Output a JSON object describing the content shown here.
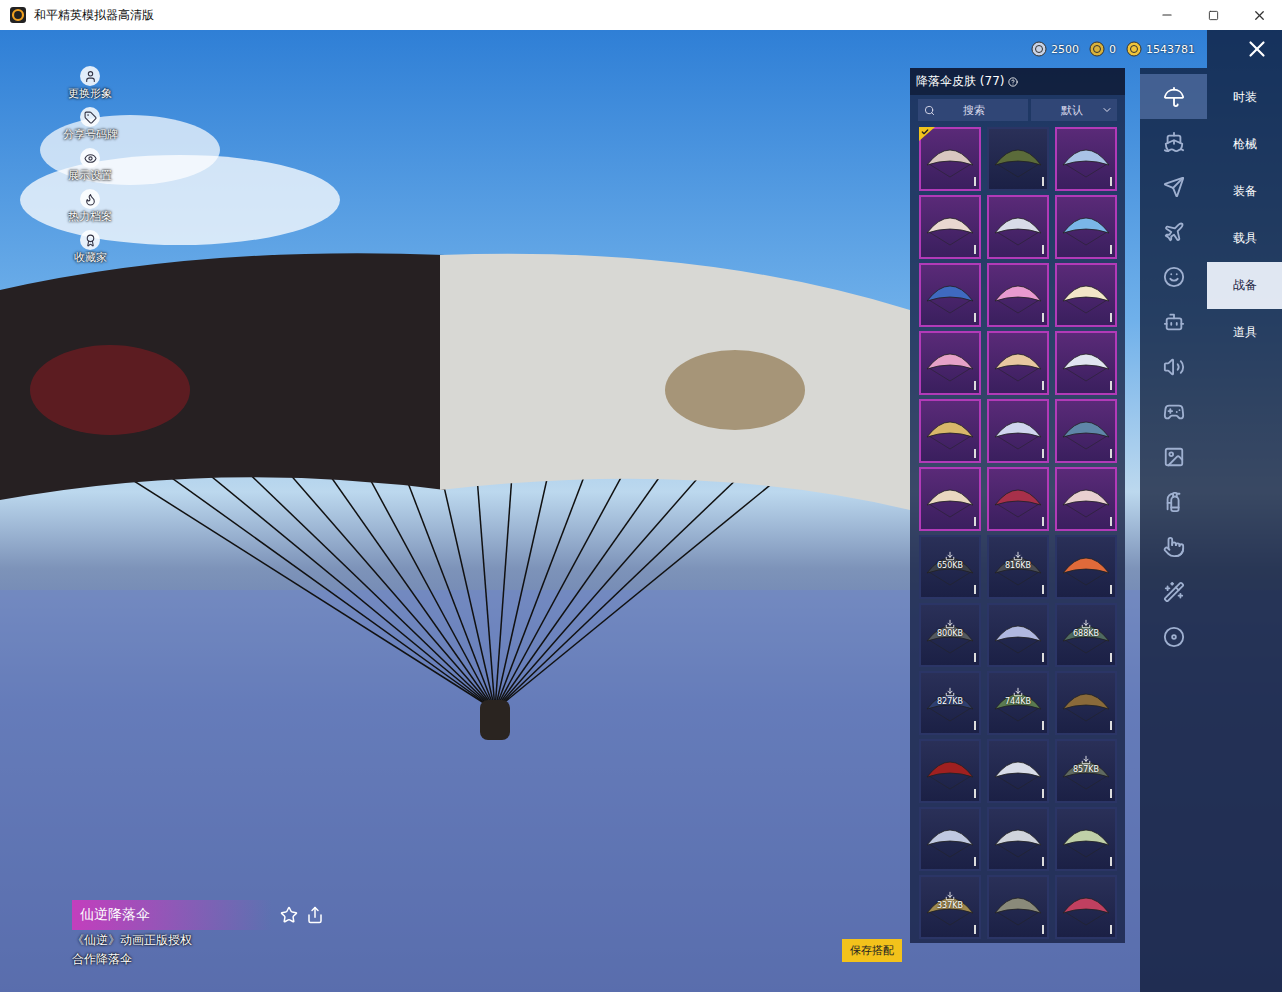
{
  "window": {
    "title": "和平精英模拟器高清版"
  },
  "side_menu": [
    {
      "label": "更换形象"
    },
    {
      "label": "分享号码牌"
    },
    {
      "label": "展示设置"
    },
    {
      "label": "热力档案"
    },
    {
      "label": "收藏家"
    }
  ],
  "currencies": [
    {
      "amount": "2500"
    },
    {
      "amount": "0"
    },
    {
      "amount": "1543781"
    }
  ],
  "panel": {
    "title": "降落伞皮肤 (77)",
    "search": {
      "placeholder": "搜索"
    },
    "sort": {
      "value": "默认"
    }
  },
  "items": [
    {
      "kind": "purple",
      "selected": true
    },
    {
      "kind": "plain",
      "selected": false
    },
    {
      "kind": "purple",
      "selected": false
    },
    {
      "kind": "purple",
      "selected": false
    },
    {
      "kind": "purple",
      "selected": false
    },
    {
      "kind": "purple",
      "selected": false
    },
    {
      "kind": "purple",
      "selected": false
    },
    {
      "kind": "purple",
      "selected": false
    },
    {
      "kind": "purple",
      "selected": false
    },
    {
      "kind": "purple",
      "selected": false
    },
    {
      "kind": "purple",
      "selected": false
    },
    {
      "kind": "purple",
      "selected": false
    },
    {
      "kind": "purple",
      "selected": false
    },
    {
      "kind": "purple",
      "selected": false
    },
    {
      "kind": "purple",
      "selected": false
    },
    {
      "kind": "purple",
      "selected": false
    },
    {
      "kind": "purple",
      "selected": false
    },
    {
      "kind": "purple",
      "selected": false
    },
    {
      "kind": "plain",
      "selected": false,
      "size": "650KB"
    },
    {
      "kind": "plain",
      "selected": false,
      "size": "816KB"
    },
    {
      "kind": "plain",
      "selected": false
    },
    {
      "kind": "plain",
      "selected": false,
      "size": "800KB"
    },
    {
      "kind": "plain",
      "selected": false
    },
    {
      "kind": "plain",
      "selected": false,
      "size": "688KB"
    },
    {
      "kind": "plain",
      "selected": false,
      "size": "827KB"
    },
    {
      "kind": "plain",
      "selected": false,
      "size": "744KB"
    },
    {
      "kind": "plain",
      "selected": false
    },
    {
      "kind": "plain",
      "selected": false
    },
    {
      "kind": "plain",
      "selected": false
    },
    {
      "kind": "plain",
      "selected": false,
      "size": "857KB"
    },
    {
      "kind": "plain",
      "selected": false
    },
    {
      "kind": "plain",
      "selected": false
    },
    {
      "kind": "plain",
      "selected": false
    },
    {
      "kind": "plain",
      "selected": false,
      "size": "337KB"
    },
    {
      "kind": "plain",
      "selected": false
    },
    {
      "kind": "plain",
      "selected": false
    }
  ],
  "icon_rail": [
    {
      "selected": true
    },
    {
      "selected": false
    },
    {
      "selected": false
    },
    {
      "selected": false
    },
    {
      "selected": false
    },
    {
      "selected": false
    },
    {
      "selected": false
    },
    {
      "selected": false
    },
    {
      "selected": false
    },
    {
      "selected": false
    },
    {
      "selected": false
    },
    {
      "selected": false
    },
    {
      "selected": false
    }
  ],
  "tabs": [
    {
      "label": "时装",
      "selected": false
    },
    {
      "label": "枪械",
      "selected": false
    },
    {
      "label": "装备",
      "selected": false
    },
    {
      "label": "载具",
      "selected": false
    },
    {
      "label": "战备",
      "selected": true
    },
    {
      "label": "道具",
      "selected": false
    }
  ],
  "detail": {
    "name": "仙逆降落伞",
    "lines": [
      "《仙逆》动画正版授权",
      "合作降落伞"
    ]
  },
  "save_button": "保存搭配"
}
